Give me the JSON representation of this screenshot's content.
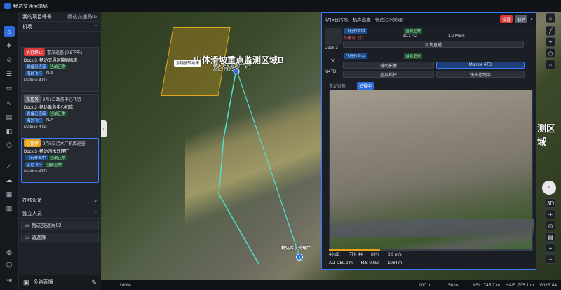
{
  "app": {
    "title": "畅达交通运输局"
  },
  "project": {
    "name": "畅达交通局02",
    "caption": "我的项目呼号"
  },
  "sections": {
    "dock": "机场",
    "online": "在线设备",
    "pilots": "独立人员"
  },
  "docks": [
    {
      "status": "执行终止",
      "status_color": "#d9383a",
      "mission": "富深巡查 (9.5下午)",
      "name": "Dock 3 -畅达交通运输局机库",
      "tag1": "设备已连接",
      "tag1b": "当前正常",
      "tag2": "海外飞行",
      "drone": "Matrice 4TD",
      "value": "N/A",
      "extra": "RID"
    },
    {
      "status": "无任务",
      "status_color": "#555c66",
      "mission": "9月1日政务中心飞行",
      "name": "Dock 3 -畅达政务中心机库",
      "tag1": "设备已连接",
      "tag1b": "当前正常",
      "tag2": "海外飞行",
      "drone": "Matrice 4TD",
      "value": "N/A",
      "extra": "RID"
    },
    {
      "status": "已暂停",
      "status_color": "#e8a21a",
      "mission": "9月5日污水厂机库巡查",
      "name": "Dock 3 -畅达污水处理厂",
      "tag1": "飞行作业中",
      "tag1b": "当前正常",
      "tag2": "正在飞行",
      "drone": "Matrice 4TD",
      "value": "",
      "extra": "RID"
    }
  ],
  "online_list": [
    "畅达交通局02",
    "请选择"
  ],
  "bottom": {
    "live": "多路直播",
    "zoom": "100%",
    "scale": "100 m",
    "scale2": "50 m",
    "asl": "ASL: 745.7 m",
    "hae": "HAE: 705.1 m",
    "crs": "WGS 84"
  },
  "map": {
    "title": "山体滑坡重点监测区域B",
    "sub": "畅达污水处理厂飞行",
    "asl": "ASL: 793.5 m",
    "popup": "泓瑞旋转地带",
    "right_label": "测区域",
    "dock_label": "畅达污水处理厂",
    "pt1": "泓瑞旋转"
  },
  "live": {
    "title": "9月5日污水厂机库巡查",
    "dock": "畅达污水处理厂",
    "btn1": "设置",
    "btn2": "取消",
    "dock_label": "Dock 3",
    "drone_label": "M4TD",
    "status1": "飞行作业中",
    "status1b": "当前正常",
    "status2": "不建议飞行",
    "temp": "30.1 °C",
    "speed": "1.0 MB/s",
    "btn_dock_live": "机场直播",
    "status3": "飞行作业中",
    "status3b": "当前正常",
    "btn_assist": "辅助影像",
    "btn_matrice": "Matrice 4TD",
    "btn_virtual": "虚拟摇杆",
    "btn_cam": "镜头控制中",
    "video_label": "自动对焦",
    "video_tag": "拍摄中",
    "t_altitude": "ALT 250.2 m",
    "t_hs": "H.S 0 m/s",
    "t_rtk": "RTK 44",
    "t_bat": "69%",
    "t_dist": "1034 m",
    "t_vs": "8.9 m/s",
    "t_sig": "40 dB",
    "timeline": "2h 1h"
  },
  "compass": {
    "label": "N",
    "mode3d": "3D"
  }
}
